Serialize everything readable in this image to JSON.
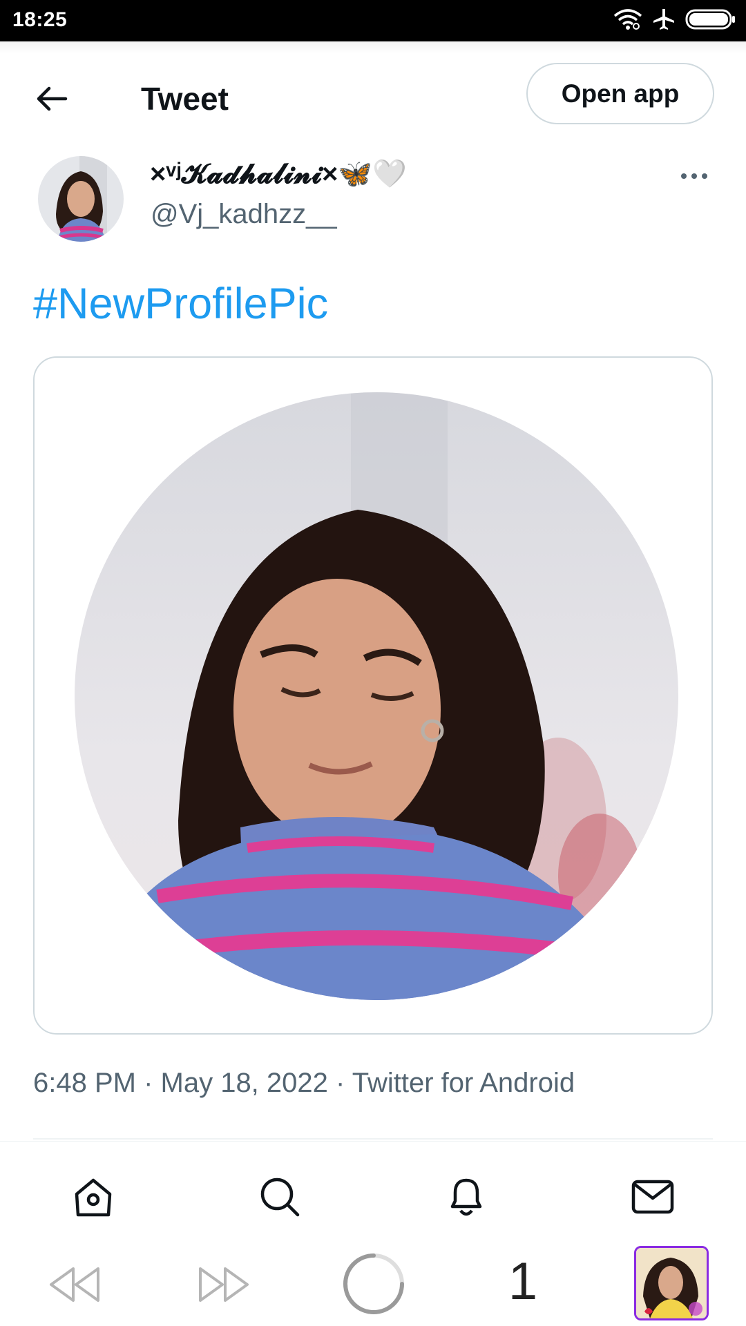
{
  "status_bar": {
    "time": "18:25",
    "icons": [
      "wifi-icon",
      "airplane-icon",
      "battery-icon"
    ]
  },
  "header": {
    "title": "Tweet",
    "open_app_label": "Open app",
    "back_icon": "back-arrow-icon"
  },
  "tweet": {
    "author": {
      "display_name": "×ᵛʲ𝓚𝓪𝓭𝓱𝓪𝓵𝓲𝓷𝓲×🦋🤍",
      "handle": "@Vj_kadhzz__"
    },
    "text": "#NewProfilePic",
    "timestamp": "6:48 PM · May 18, 2022 · Twitter for Android"
  },
  "bottom_nav": {
    "items": [
      {
        "name": "home",
        "icon": "home-icon"
      },
      {
        "name": "search",
        "icon": "search-icon"
      },
      {
        "name": "notifications",
        "icon": "bell-icon"
      },
      {
        "name": "messages",
        "icon": "mail-icon"
      }
    ]
  },
  "browser_bar": {
    "tab_count": "1",
    "icons": [
      "rewind-icon",
      "fast-forward-icon",
      "loading-icon",
      "tab-thumbnail"
    ]
  },
  "colors": {
    "accent": "#1d9bf0",
    "secondary_text": "#536471",
    "border": "#cfd9de",
    "tab_border": "#8a2be2"
  }
}
